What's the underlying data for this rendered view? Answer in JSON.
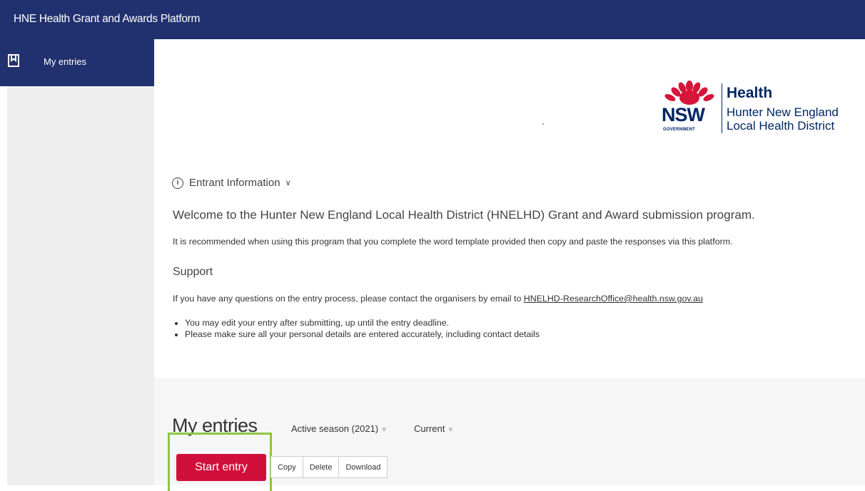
{
  "header": {
    "title": "HNE Health Grant and Awards Platform"
  },
  "sidebar": {
    "items": [
      {
        "label": "My entries",
        "icon": "bookmark-icon"
      }
    ]
  },
  "logo": {
    "nsw": "NSW",
    "government": "GOVERNMENT",
    "health": "Health",
    "line1": "Hunter New England",
    "line2": "Local Health District"
  },
  "stray_dot": ".",
  "entrant": {
    "label": "Entrant Information"
  },
  "welcome": "Welcome to the Hunter New England Local Health District (HNELHD) Grant and Award submission program.",
  "recommend": "It is recommended when using this program that you complete the word template provided then copy and paste the responses via this platform.",
  "support": {
    "heading": "Support",
    "text": "If you have any questions on the entry process, please contact the organisers by email to",
    "email": "HNELHD-ResearchOffice@health.nsw.gov.au",
    "bullets": [
      "You may edit your entry after submitting, up until the entry deadline.",
      "Please make sure all your personal details are entered accurately, including contact details"
    ]
  },
  "entries": {
    "heading": "My entries",
    "season_filter": "Active season (2021)",
    "status_filter": "Current",
    "start_button": "Start entry",
    "actions": [
      "Copy",
      "Delete",
      "Download"
    ]
  },
  "colors": {
    "brand_navy": "#21306e",
    "start_red": "#d0103a",
    "highlight_green": "#8cc63f",
    "logo_red": "#d7153a",
    "logo_navy": "#002664"
  }
}
